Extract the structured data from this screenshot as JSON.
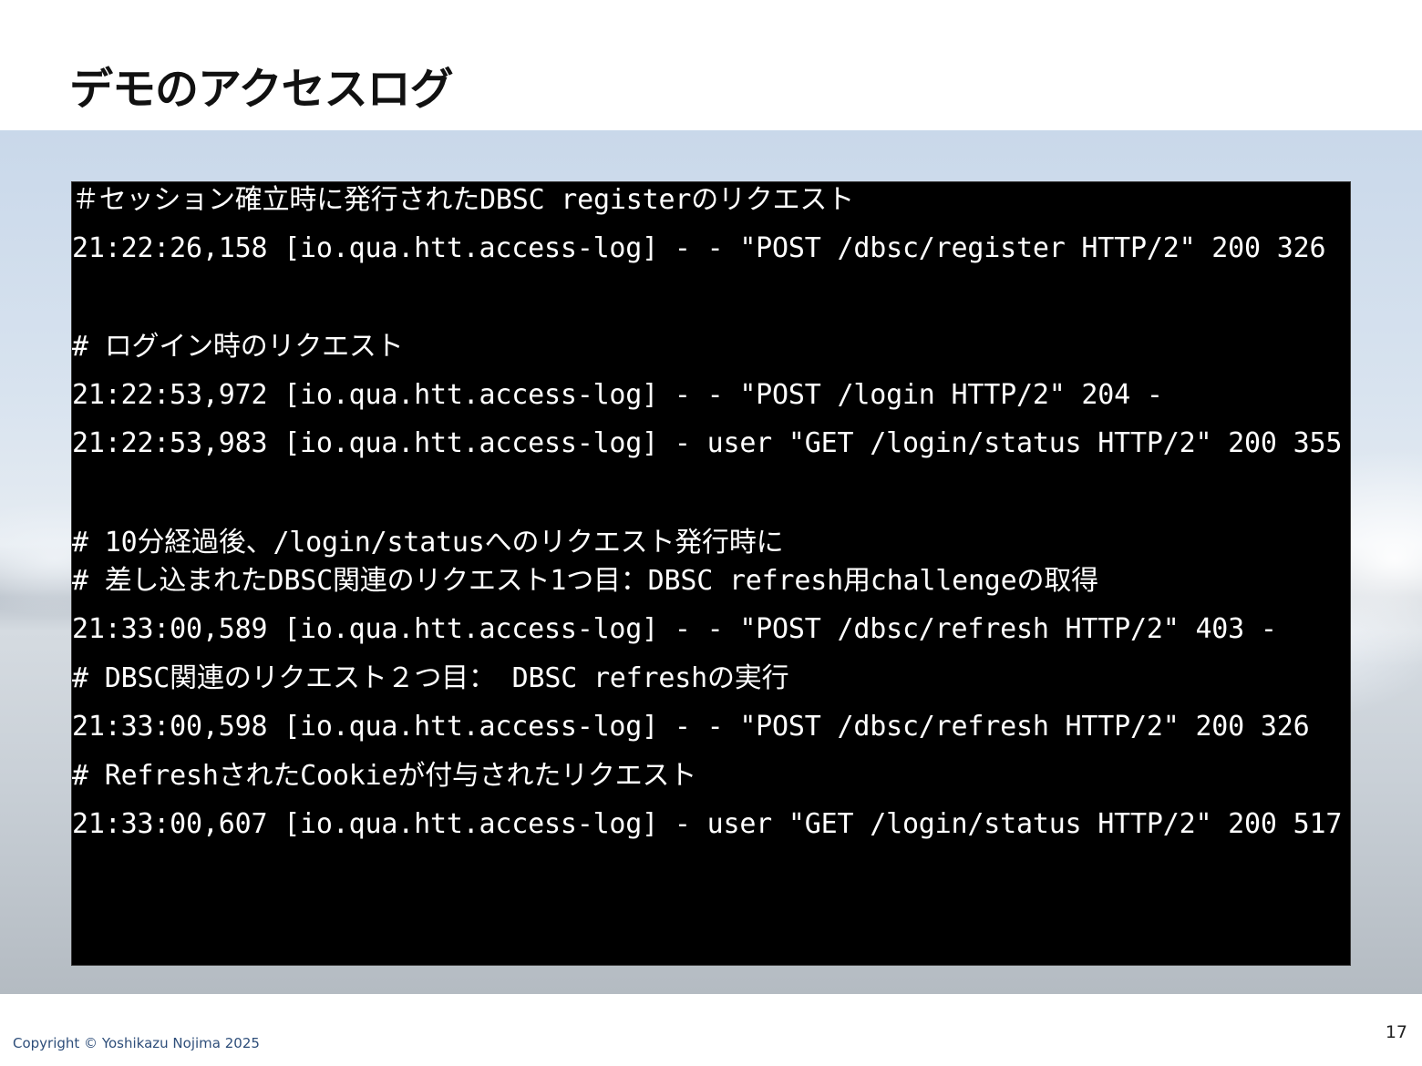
{
  "slide": {
    "title": "デモのアクセスログ",
    "copyright": "Copyright © Yoshikazu Nojima 2025",
    "page_number": "17"
  },
  "log": {
    "lines": [
      "＃セッション確立時に発行されたDBSC registerのリクエスト",
      "21:22:26,158 [io.qua.htt.access-log] - -      \"POST /dbsc/register HTTP/2\" 200 326",
      "# ログイン時のリクエスト",
      "21:22:53,972 [io.qua.htt.access-log] - -      \"POST /login HTTP/2\" 204 -",
      "21:22:53,983 [io.qua.htt.access-log] - user \"GET /login/status HTTP/2\" 200 355",
      "# 10分経過後、/login/statusへのリクエスト発行時に",
      "# 差し込まれたDBSC関連のリクエスト1つ目：DBSC refresh用challengeの取得",
      "21:33:00,589 [io.qua.htt.access-log] - -      \"POST /dbsc/refresh HTTP/2\" 403 -",
      "# DBSC関連のリクエスト２つ目： DBSC refreshの実行",
      "21:33:00,598 [io.qua.htt.access-log] - -      \"POST /dbsc/refresh HTTP/2\" 200 326",
      "# RefreshされたCookieが付与されたリクエスト",
      "21:33:00,607 [io.qua.htt.access-log] - user \"GET /login/status HTTP/2\" 200 517"
    ]
  }
}
